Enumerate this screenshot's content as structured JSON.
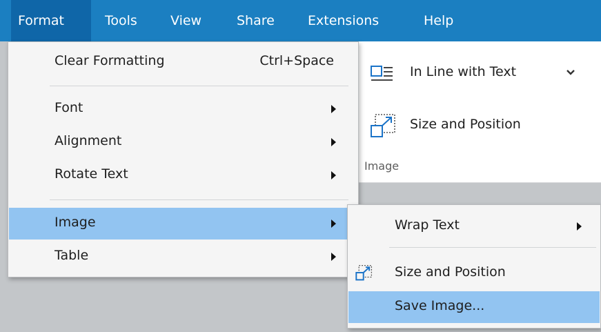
{
  "menubar": {
    "items": [
      "Format",
      "Tools",
      "View",
      "Share",
      "Extensions",
      "Help"
    ],
    "active": "Format"
  },
  "ribbon": {
    "wrap_label": "In Line with Text",
    "size_label": "Size and Position",
    "group_label": "Image"
  },
  "format_menu": {
    "clear": {
      "label": "Clear Formatting",
      "shortcut": "Ctrl+Space"
    },
    "font": "Font",
    "alignment": "Alignment",
    "rotate": "Rotate Text",
    "image": "Image",
    "table": "Table",
    "highlighted": "Image"
  },
  "image_submenu": {
    "wrap": "Wrap Text",
    "size": "Size and Position",
    "save": "Save Image...",
    "highlighted": "Save Image..."
  },
  "colors": {
    "menubar": "#1b7fc1",
    "menubar_active": "#0f66a8",
    "highlight": "#92c4f1",
    "icon_blue": "#1a73c8"
  },
  "icons": [
    "wrap-text-icon",
    "size-position-icon",
    "chevron-down-icon",
    "submenu-arrow-icon"
  ]
}
